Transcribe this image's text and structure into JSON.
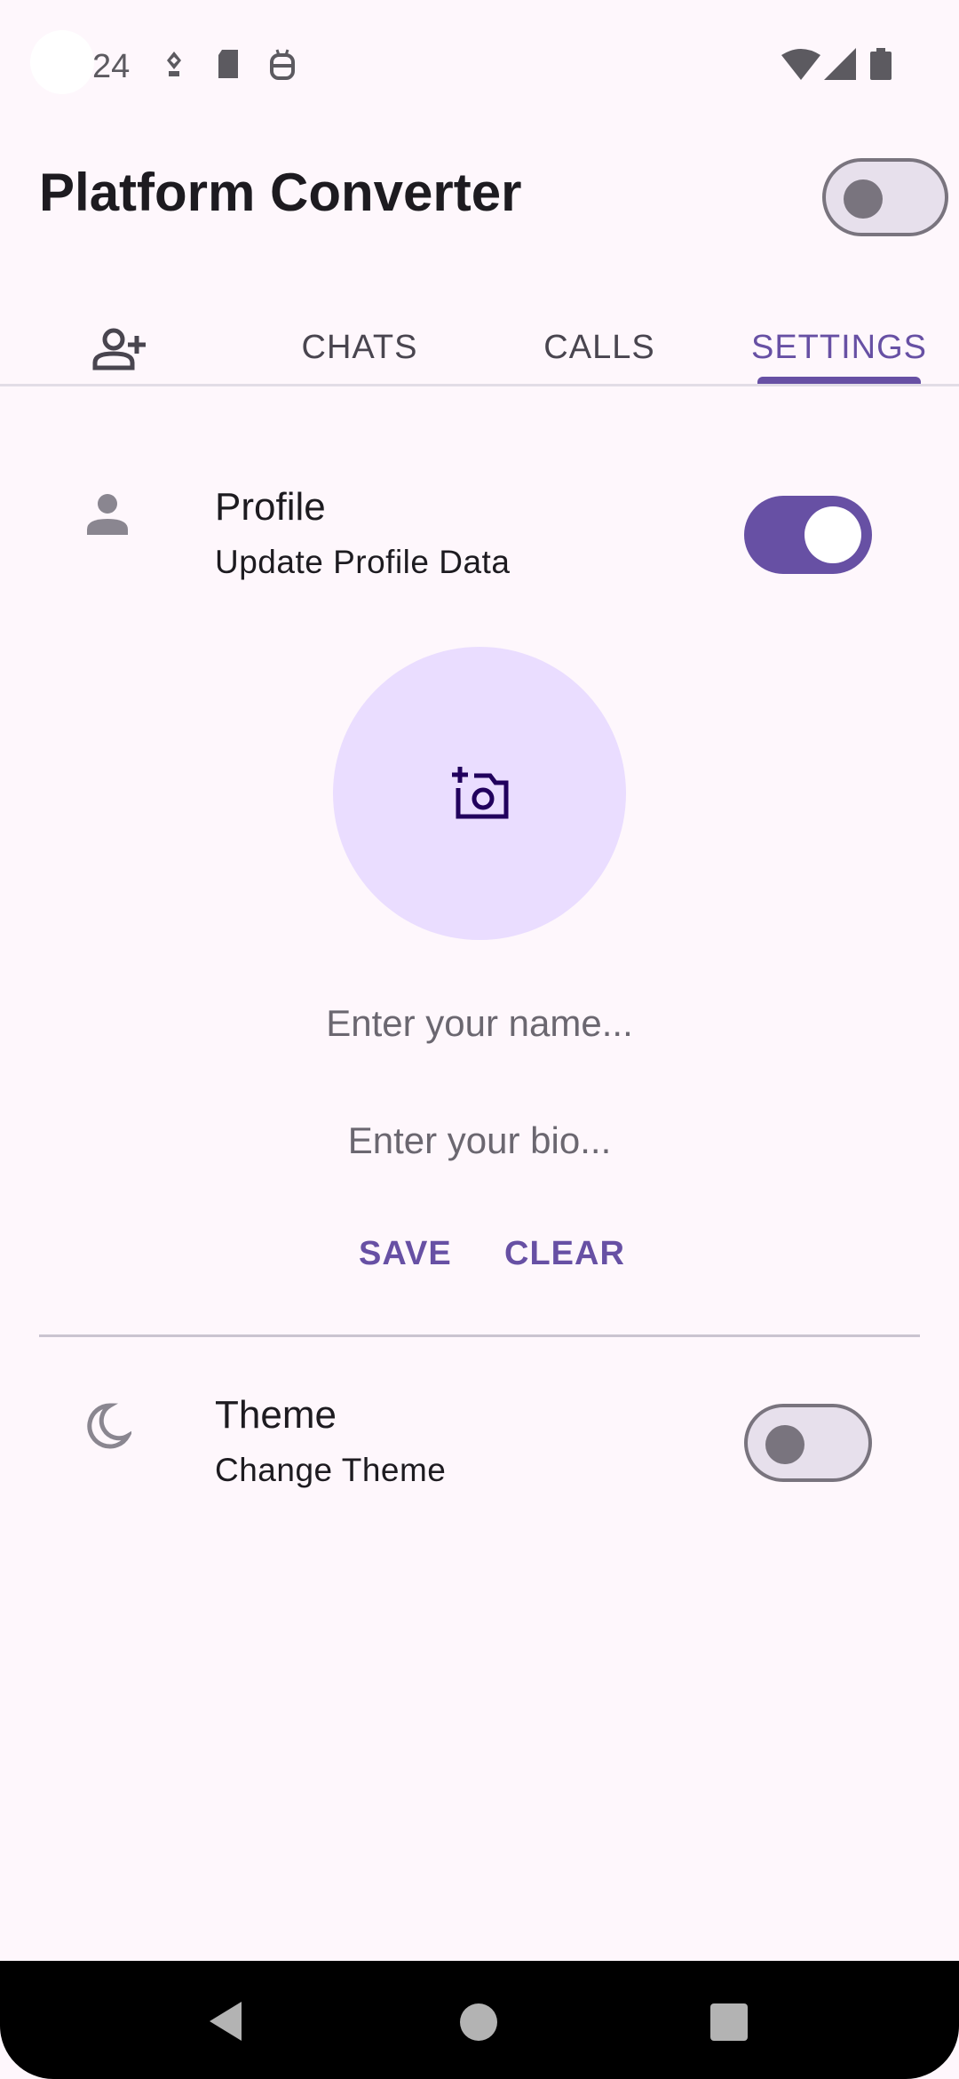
{
  "status_bar": {
    "time": "24",
    "left_icons": [
      "vpn-key-icon",
      "sd-card-icon",
      "android-robot-icon"
    ],
    "right_icons": [
      "wifi-icon",
      "cell-signal-icon",
      "battery-icon"
    ]
  },
  "app_bar": {
    "title": "Platform Converter",
    "theme_switch_on": false
  },
  "tabs": [
    {
      "icon": "person-add-icon",
      "label": ""
    },
    {
      "label": "CHATS"
    },
    {
      "label": "CALLS"
    },
    {
      "label": "SETTINGS",
      "active": true
    }
  ],
  "profile": {
    "icon": "person-icon",
    "title": "Profile",
    "subtitle": "Update Profile Data",
    "switch_on": true,
    "avatar_icon": "add-a-photo-icon",
    "name_placeholder": "Enter your name...",
    "bio_placeholder": "Enter your bio...",
    "save_label": "SAVE",
    "clear_label": "CLEAR"
  },
  "theme": {
    "icon": "dark-mode-icon",
    "title": "Theme",
    "subtitle": "Change Theme",
    "switch_on": false
  },
  "nav_bar": {
    "icons": [
      "back-icon",
      "home-icon",
      "recents-icon"
    ]
  },
  "colors": {
    "primary": "#6750a4",
    "background": "#fef7fc",
    "avatar_bg": "#eaddff"
  }
}
